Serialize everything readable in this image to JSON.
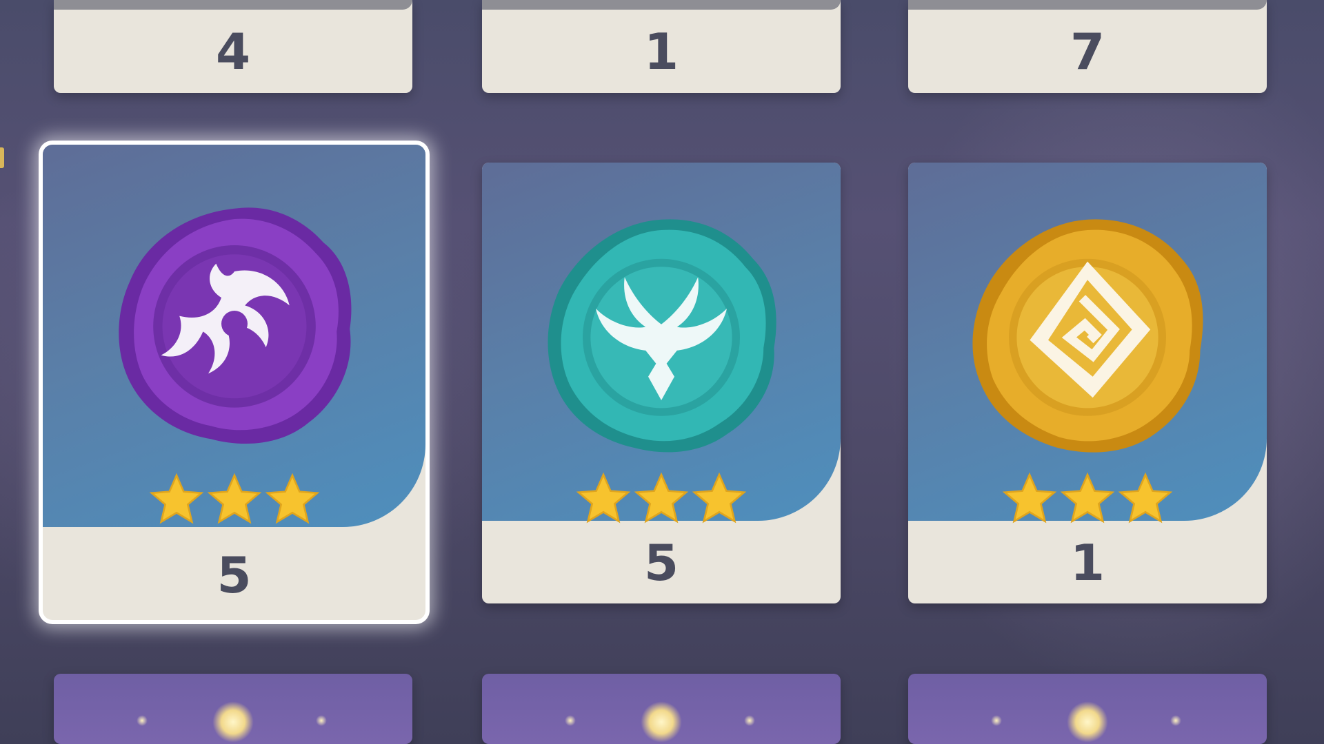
{
  "inventory": {
    "top_row": [
      {
        "count": "4"
      },
      {
        "count": "1"
      },
      {
        "count": "7"
      }
    ],
    "middle_row": [
      {
        "element": "Electro",
        "icon": "electro-seal-icon",
        "rarity": 3,
        "count": "5",
        "selected": true,
        "color": "#7e35b8"
      },
      {
        "element": "Anemo",
        "icon": "anemo-seal-icon",
        "rarity": 3,
        "count": "5",
        "selected": false,
        "color": "#2fb3b0"
      },
      {
        "element": "Geo",
        "icon": "geo-seal-icon",
        "rarity": 3,
        "count": "1",
        "selected": false,
        "color": "#e0a521"
      }
    ],
    "bottom_row": [
      {
        "icon": "glowing-item-icon"
      },
      {
        "icon": "glowing-item-icon"
      },
      {
        "icon": "glowing-item-icon"
      }
    ]
  },
  "colors": {
    "card_footer": "#e9e5dc",
    "card_art": "#5a7fa8",
    "star": "#f7c32e",
    "count_text": "#4a4c5e"
  }
}
